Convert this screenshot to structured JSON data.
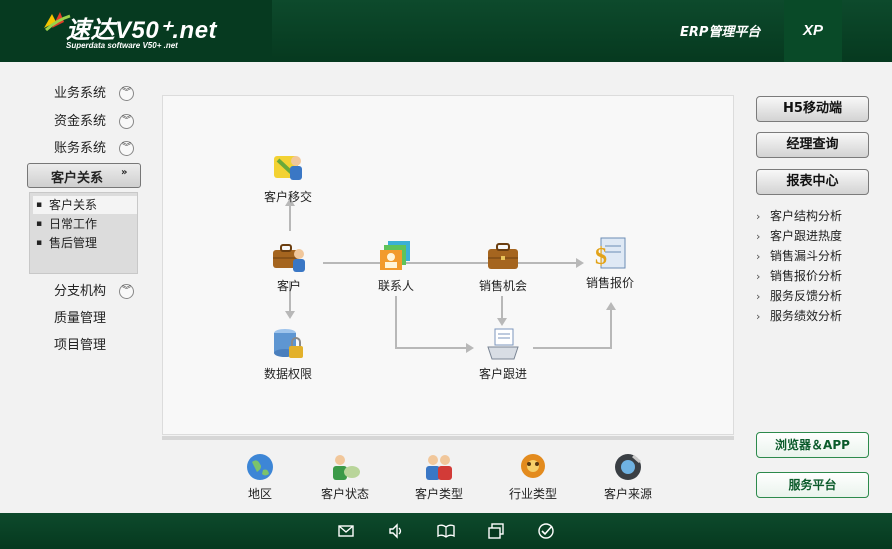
{
  "header": {
    "logo_title": "速达V50⁺.net",
    "logo_subtitle": "Superdata software V50+ .net",
    "platform": "ERP管理平台",
    "edition": "XP"
  },
  "sidebar": {
    "items": [
      {
        "label": "业务系统",
        "expandable": true
      },
      {
        "label": "资金系统",
        "expandable": true
      },
      {
        "label": "账务系统",
        "expandable": true
      },
      {
        "label": "客户关系",
        "expandable": true,
        "active": true
      },
      {
        "label": "分支机构",
        "expandable": true
      },
      {
        "label": "质量管理",
        "expandable": false
      },
      {
        "label": "项目管理",
        "expandable": false
      }
    ],
    "active_arrow": "»",
    "submenu": [
      {
        "label": "客户关系",
        "selected": true
      },
      {
        "label": "日常工作",
        "selected": false
      },
      {
        "label": "售后管理",
        "selected": false
      }
    ]
  },
  "flow": {
    "nodes": {
      "transfer": "客户移交",
      "customer": "客户",
      "contact": "联系人",
      "opportunity": "销售机会",
      "quote": "销售报价",
      "permission": "数据权限",
      "followup": "客户跟进"
    }
  },
  "bottom": {
    "items": [
      "地区",
      "客户状态",
      "客户类型",
      "行业类型",
      "客户来源"
    ]
  },
  "right": {
    "buttons": [
      "H5移动端",
      "经理查询",
      "报表中心"
    ],
    "links": [
      "客户结构分析",
      "客户跟进热度",
      "销售漏斗分析",
      "销售报价分析",
      "服务反馈分析",
      "服务绩效分析"
    ],
    "green_buttons": [
      "浏览器＆APP",
      "服务平台"
    ]
  },
  "colors": {
    "header_bg": "#06391f",
    "accent_green": "#0b5b2b",
    "canvas_bg": "#f8f8f8"
  },
  "footer": {
    "icons": [
      "mail-icon",
      "volume-icon",
      "book-icon",
      "window-icon",
      "check-icon"
    ]
  }
}
